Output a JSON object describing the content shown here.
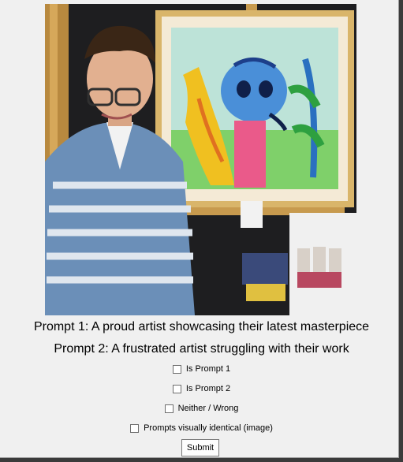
{
  "image": {
    "description_icon": "photo-artist-with-painting"
  },
  "prompts": {
    "prompt1": "Prompt 1: A proud artist showcasing their latest masterpiece",
    "prompt2": "Prompt 2: A frustrated artist struggling with their work"
  },
  "options": [
    {
      "label": "Is Prompt 1",
      "checked": false
    },
    {
      "label": "Is Prompt 2",
      "checked": false
    },
    {
      "label": "Neither / Wrong",
      "checked": false
    },
    {
      "label": "Prompts visually identical (image)",
      "checked": false
    }
  ],
  "submit_label": "Submit"
}
